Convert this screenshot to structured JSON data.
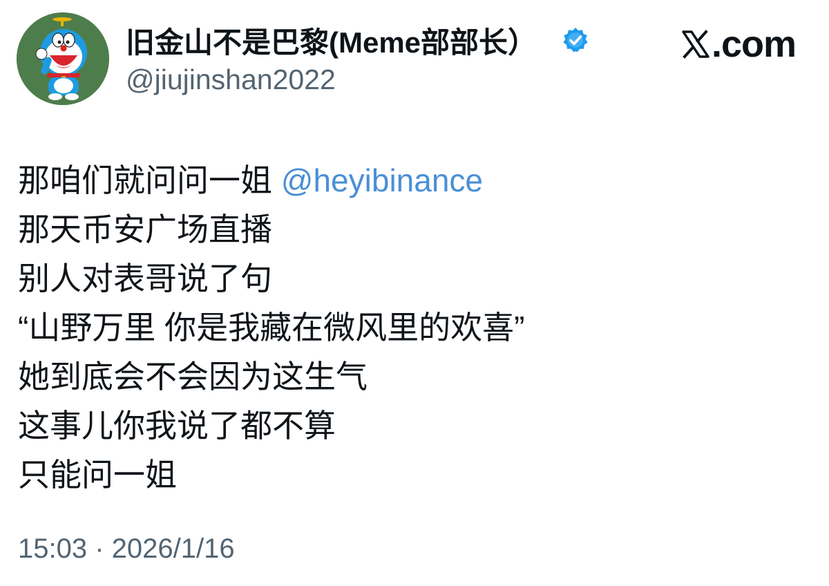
{
  "tweet": {
    "author": {
      "display_name": "旧金山不是巴黎(Meme部部长）",
      "handle": "@jiujinshan2022",
      "verified": true,
      "avatar_icon": "doraemon-avatar-icon",
      "avatar_bg": "#4e7d4c"
    },
    "brand": {
      "text": ".com",
      "icon": "x-logo-icon"
    },
    "lines": [
      {
        "text": "那咱们就问问一姐 ",
        "mention": "@heyibinance"
      },
      {
        "text": "那天币安广场直播"
      },
      {
        "text": "别人对表哥说了句"
      },
      {
        "text": "“山野万里 你是我藏在微风里的欢喜”"
      },
      {
        "text": "她到底会不会因为这生气"
      },
      {
        "text": "这事儿你我说了都不算"
      },
      {
        "text": "只能问一姐"
      }
    ],
    "timestamp": "15:03 · 2026/1/16"
  },
  "colors": {
    "text": "#0f1419",
    "secondary": "#536471",
    "mention": "#4a8fd6",
    "verified": "#1d9bf0"
  }
}
